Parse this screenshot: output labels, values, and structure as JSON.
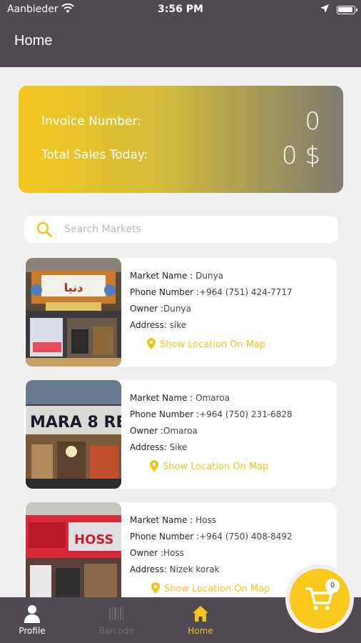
{
  "status_bar": {
    "carrier": "Aanbieder",
    "time": "3:56 PM"
  },
  "header": {
    "title": "Home"
  },
  "summary": {
    "invoice_label": "Invoice Number:",
    "invoice_value": "0",
    "sales_label": "Total Sales Today:",
    "sales_value": "0 $"
  },
  "search": {
    "placeholder": "Search Markets"
  },
  "labels": {
    "market_name": "Market Name : ",
    "phone": "Phone Number :",
    "owner": "Owner :",
    "address": "Address: ",
    "map_link": "Show Location On Map"
  },
  "markets": [
    {
      "name": "Dunya",
      "phone": "+964 (751) 424-7717",
      "owner": "Dunya",
      "address": "sike",
      "sign_text": "دنيا"
    },
    {
      "name": "Omaroa",
      "phone": "+964 (750) 231-6828",
      "owner": "Omaroa",
      "address": "Sike",
      "sign_text": "MARA 8 RE"
    },
    {
      "name": "Hoss",
      "phone": "+964 (750) 408-8492",
      "owner": "Hoss",
      "address": "Nizek korak",
      "sign_text": "HOSS"
    }
  ],
  "bottom_nav": {
    "items": [
      {
        "label": "Profile",
        "icon": "person-icon",
        "state": "normal"
      },
      {
        "label": "Barcode",
        "icon": "barcode-icon",
        "state": "disabled"
      },
      {
        "label": "Home",
        "icon": "home-icon",
        "state": "active"
      }
    ]
  },
  "cart": {
    "count": "0"
  },
  "colors": {
    "accent": "#f6c21d",
    "bar": "#4f4a52",
    "background": "#efefef"
  }
}
